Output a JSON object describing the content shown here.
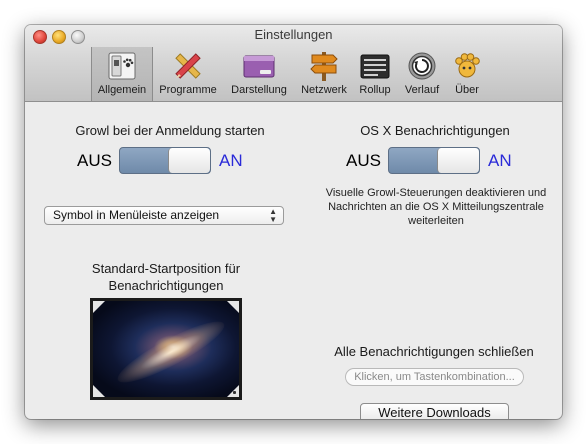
{
  "window": {
    "title": "Einstellungen"
  },
  "toolbar": {
    "items": [
      {
        "label": "Allgemein",
        "icon": "general-switch-icon",
        "selected": true
      },
      {
        "label": "Programme",
        "icon": "pencil-ruler-icon",
        "selected": false
      },
      {
        "label": "Darstellung",
        "icon": "display-window-icon",
        "selected": false
      },
      {
        "label": "Netzwerk",
        "icon": "signpost-icon",
        "selected": false
      },
      {
        "label": "Rollup",
        "icon": "rollup-window-icon",
        "selected": false
      },
      {
        "label": "Verlauf",
        "icon": "history-icon",
        "selected": false
      },
      {
        "label": "Über",
        "icon": "growl-paw-icon",
        "selected": false
      }
    ]
  },
  "left": {
    "login_heading": "Growl bei der Anmeldung starten",
    "login_switch": {
      "off_label": "AUS",
      "on_label": "AN",
      "state": "on"
    },
    "menu_popup": {
      "selected": "Symbol in Menüleiste anzeigen"
    },
    "position_heading": "Standard-Startposition für Benachrichtigungen"
  },
  "right": {
    "osx_heading": "OS X Benachrichtigungen",
    "osx_switch": {
      "off_label": "AUS",
      "on_label": "AN",
      "state": "on"
    },
    "osx_description": "Visuelle Growl-Steuerungen deaktivieren und Nachrichten an die OS X Mitteilungszentrale weiterleiten",
    "close_all_heading": "Alle Benachrichtigungen schließen",
    "shortcut_placeholder": "Klicken, um Tastenkombination...",
    "downloads_button": "Weitere Downloads"
  },
  "colors": {
    "switch_on_label": "#2a2ad8",
    "switch_track": "#7f98b6",
    "window_bg": "#ececec"
  }
}
